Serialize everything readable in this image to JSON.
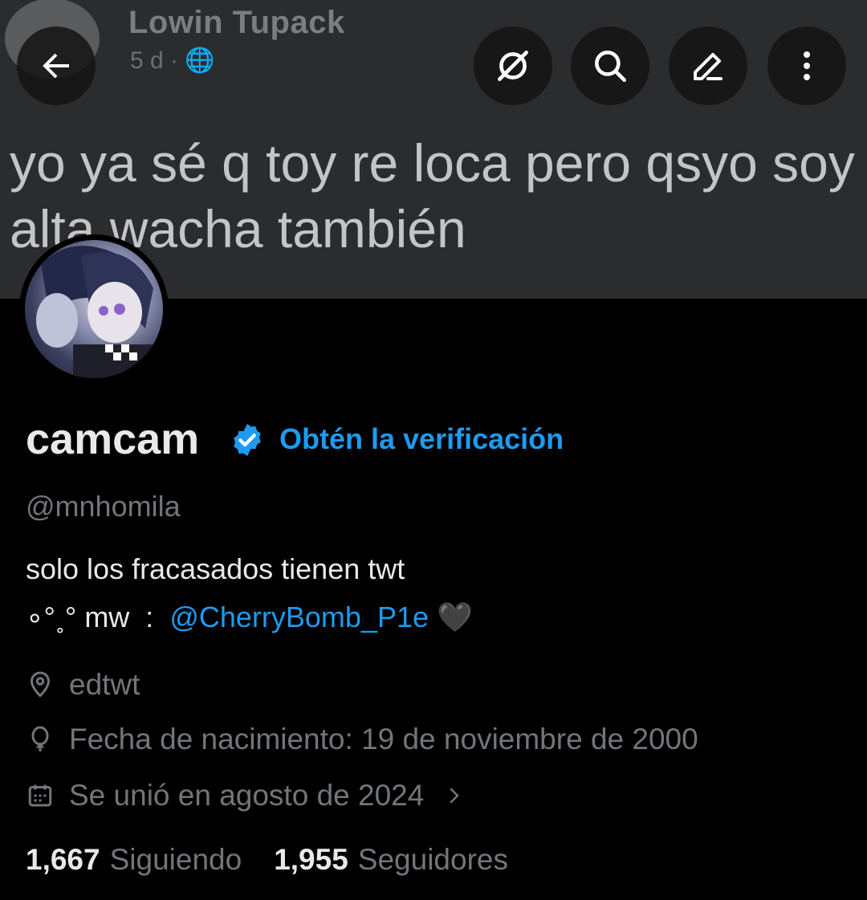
{
  "banner": {
    "author_name": "Lowin Tupack",
    "author_meta": "5 d · ",
    "post_text": "yo ya sé q toy re loca pero qsyo soy\nalta wacha también"
  },
  "toolbar": {
    "back_icon": "arrow-left-icon",
    "grok_icon": "grok-icon",
    "search_icon": "search-icon",
    "edit_icon": "edit-icon",
    "more_icon": "more-vertical-icon"
  },
  "profile": {
    "display_name": "camcam",
    "verify_cta": "Obtén la verificación",
    "handle": "@mnhomila",
    "bio_line1": "solo los fracasados tienen twt",
    "bio_line2_prefix": "∘°˳° mw  :  ",
    "bio_mention": "@CherryBomb_P1e",
    "bio_emoji": "🖤",
    "location": "edtwt",
    "birthday": "Fecha de nacimiento: 19 de noviembre de 2000",
    "joined": "Se unió en agosto de 2024",
    "following_count": "1,667",
    "following_label": "Siguiendo",
    "followers_count": "1,955",
    "followers_label": "Seguidores"
  },
  "colors": {
    "accent": "#1d9bf0",
    "text": "#e7e9ea",
    "muted": "#71767b",
    "background": "#000000"
  }
}
